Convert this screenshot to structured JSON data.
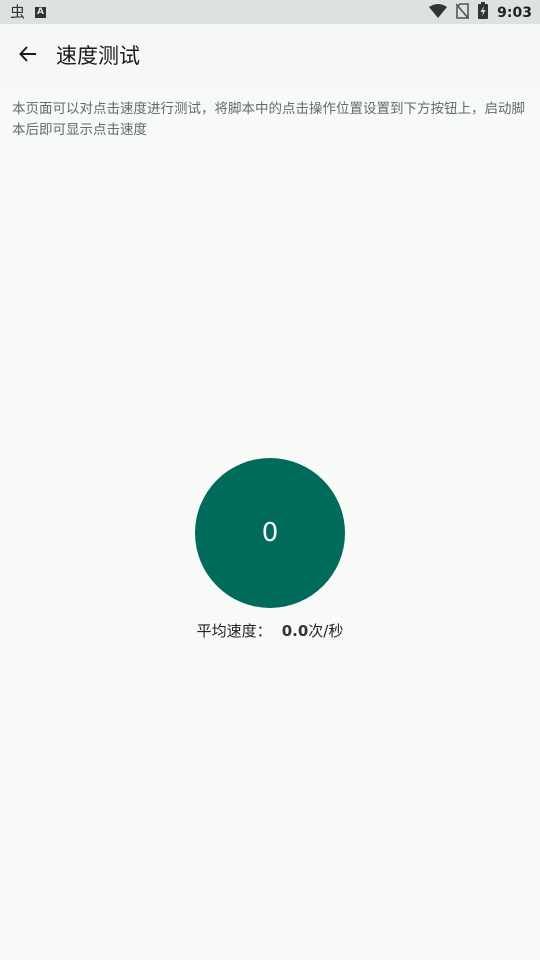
{
  "status_bar": {
    "left_icons": [
      "app-notification-icon",
      "a-box-icon"
    ],
    "right_icons": [
      "wifi-icon",
      "no-sim-icon",
      "battery-charging-icon"
    ],
    "app_glyph": "虫",
    "box_glyph": "A",
    "time": "9:03"
  },
  "app_bar": {
    "title": "速度测试"
  },
  "description": "本页面可以对点击速度进行测试，将脚本中的点击操作位置设置到下方按钮上，启动脚本后即可显示点击速度",
  "tap_button": {
    "count": "0",
    "color": "#006b5a"
  },
  "average": {
    "label": "平均速度：",
    "value": "0.0",
    "unit": "次/秒"
  }
}
